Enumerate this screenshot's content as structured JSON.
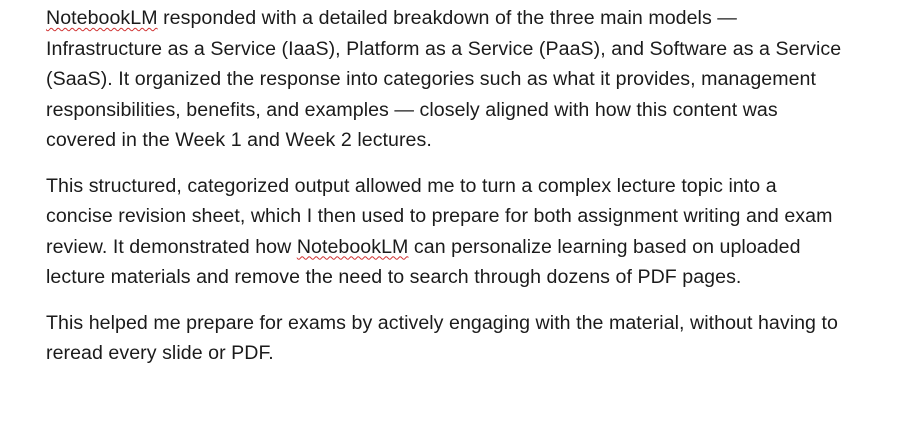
{
  "document": {
    "paragraphs": [
      {
        "lines": [
          {
            "flagged": "NotebookLM",
            "rest": " responded with a detailed breakdown of the three main models —"
          },
          {
            "text": "Infrastructure as a Service (IaaS), Platform as a Service (PaaS), and Software as a Service"
          },
          {
            "text": "(SaaS). It organized the response into categories such as what it provides, management"
          },
          {
            "text": "responsibilities, benefits, and examples — closely aligned with how this content was"
          },
          {
            "text": "covered in the Week 1 and Week 2 lectures."
          }
        ]
      },
      {
        "lines": [
          {
            "text": "This structured, categorized output allowed me to turn a complex lecture topic into a"
          },
          {
            "text": "concise revision sheet, which I then used to prepare for both assignment writing and exam"
          },
          {
            "before": "review. It demonstrated how ",
            "flagged": "NotebookLM",
            "rest": " can personalize learning based on uploaded"
          },
          {
            "text": "lecture materials and remove the need to search through dozens of PDF pages."
          }
        ]
      },
      {
        "lines": [
          {
            "text": "This helped me prepare for exams by actively engaging with the material, without having to"
          },
          {
            "text": "reread every slide or PDF."
          }
        ]
      }
    ],
    "spellcheck_color": "#d03030",
    "text_color": "#1b1b1b"
  }
}
